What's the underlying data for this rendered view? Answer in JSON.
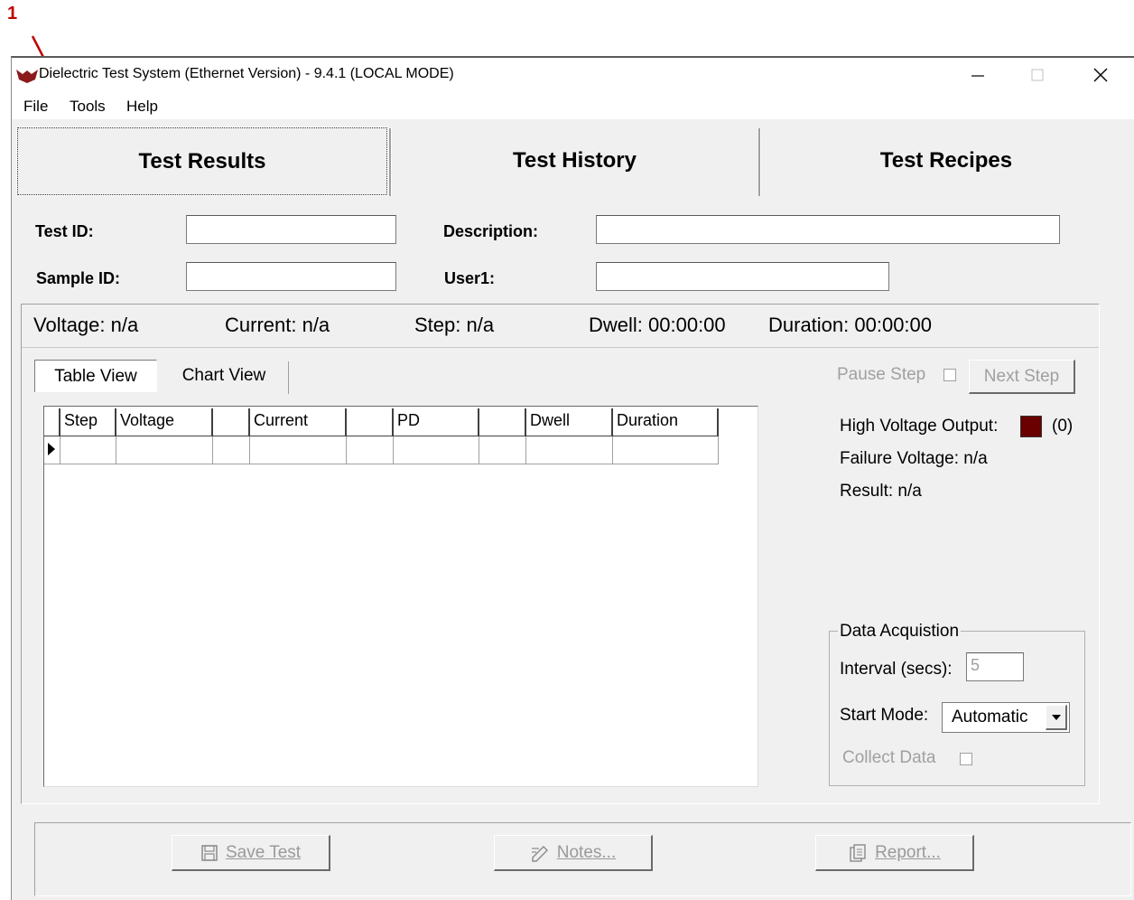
{
  "annotation": {
    "number": "1"
  },
  "window": {
    "title": "Dielectric Test System (Ethernet Version) - 9.4.1  (LOCAL MODE)",
    "app_icon": "bat-logo-icon",
    "controls": {
      "minimize": "minimize-icon",
      "maximize": "maximize-icon",
      "close": "close-icon"
    }
  },
  "menu": {
    "items": [
      "File",
      "Tools",
      "Help"
    ]
  },
  "tabs": [
    "Test Results",
    "Test History",
    "Test Recipes"
  ],
  "form": {
    "test_id_label": "Test ID:",
    "sample_id_label": "Sample ID:",
    "description_label": "Description:",
    "user1_label": "User1:",
    "test_id_value": "",
    "sample_id_value": "",
    "description_value": "",
    "user1_value": ""
  },
  "status": {
    "voltage": "Voltage: n/a",
    "current": "Current: n/a",
    "step": "Step: n/a",
    "dwell": "Dwell: 00:00:00",
    "duration": "Duration:  00:00:00"
  },
  "subtabs": [
    "Table View",
    "Chart View"
  ],
  "grid": {
    "columns": [
      "Step",
      "Voltage",
      "",
      "Current",
      "",
      "PD",
      "",
      "Dwell",
      "Duration"
    ],
    "rows": [
      [
        "",
        "",
        "",
        "",
        "",
        "",
        "",
        "",
        ""
      ]
    ]
  },
  "controls": {
    "pause_step": "Pause Step",
    "next_step": "Next Step",
    "hv_output_label": "High Voltage Output:",
    "hv_output_value": "(0)",
    "hv_indicator_color": "#6b0000",
    "failure_voltage": "Failure Voltage: n/a",
    "result": "Result: n/a"
  },
  "data_acquisition": {
    "title": "Data Acquistion",
    "interval_label": "Interval (secs):",
    "interval_value": "5",
    "start_mode_label": "Start Mode:",
    "start_mode_value": "Automatic",
    "collect_data_label": "Collect Data"
  },
  "bottom_buttons": {
    "save": {
      "label": "Save Test",
      "icon": "floppy-disk-icon"
    },
    "notes": {
      "label": "Notes...",
      "icon": "notes-icon"
    },
    "report": {
      "label": "Report...",
      "icon": "report-icon"
    }
  },
  "colors": {
    "annotation_red": "#c00000"
  }
}
